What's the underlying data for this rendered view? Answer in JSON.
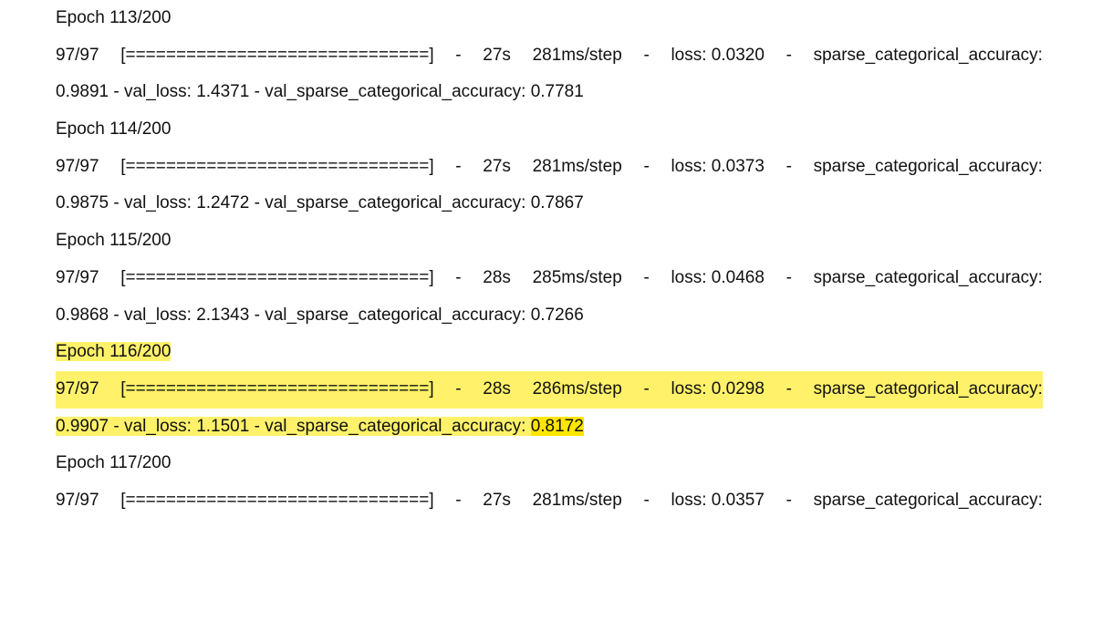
{
  "entries": [
    {
      "epoch": "Epoch 113/200",
      "progress": "97/97",
      "bar": "[==============================]",
      "dash1": "-",
      "time": "27s",
      "step": "281ms/step",
      "dash2": "-",
      "loss": "loss: 0.0320",
      "dash3": "-",
      "acc_label": "sparse_categorical_accuracy:",
      "tail_prefix": "0.9891 - val_loss: 1.4371 - val_sparse_categorical_accuracy: ",
      "tail_value": "0.7781"
    },
    {
      "epoch": "Epoch 114/200",
      "progress": "97/97",
      "bar": "[==============================]",
      "dash1": "-",
      "time": "27s",
      "step": "281ms/step",
      "dash2": "-",
      "loss": "loss: 0.0373",
      "dash3": "-",
      "acc_label": "sparse_categorical_accuracy:",
      "tail_prefix": "0.9875 - val_loss: 1.2472 - val_sparse_categorical_accuracy: ",
      "tail_value": "0.7867"
    },
    {
      "epoch": "Epoch 115/200",
      "progress": "97/97",
      "bar": "[==============================]",
      "dash1": "-",
      "time": "28s",
      "step": "285ms/step",
      "dash2": "-",
      "loss": "loss: 0.0468",
      "dash3": "-",
      "acc_label": "sparse_categorical_accuracy:",
      "tail_prefix": "0.9868 - val_loss: 2.1343 - val_sparse_categorical_accuracy: ",
      "tail_value": "0.7266"
    },
    {
      "epoch": "Epoch 116/200",
      "progress": "97/97",
      "bar": "[==============================]",
      "dash1": "-",
      "time": "28s",
      "step": "286ms/step",
      "dash2": "-",
      "loss": "loss: 0.0298",
      "dash3": "-",
      "acc_label": "sparse_categorical_accuracy:",
      "tail_prefix": "0.9907 - val_loss: 1.1501 - val_sparse_categorical_accuracy: ",
      "tail_value": "0.8172"
    },
    {
      "epoch": "Epoch 117/200",
      "progress": "97/97",
      "bar": "[==============================]",
      "dash1": "-",
      "time": "27s",
      "step": "281ms/step",
      "dash2": "-",
      "loss": "loss: 0.0357",
      "dash3": "-",
      "acc_label": "sparse_categorical_accuracy:"
    }
  ],
  "highlight": {
    "entry_index": 3,
    "color": "#fff26a",
    "value_color": "#ffe600"
  }
}
